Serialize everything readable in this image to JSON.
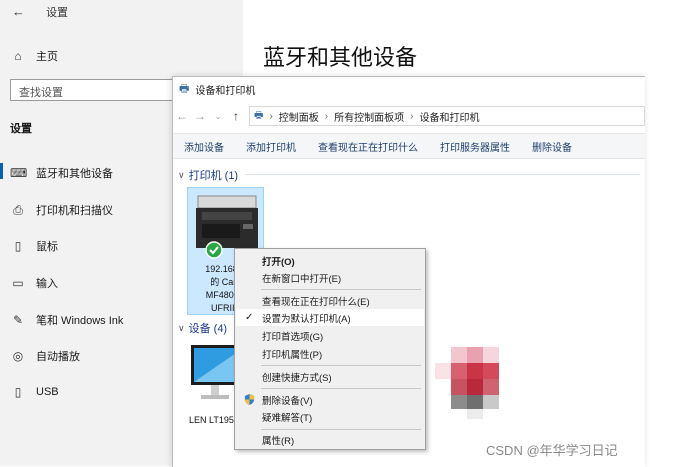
{
  "settings": {
    "back_label": "设置",
    "home": "主页",
    "search_placeholder": "查找设置",
    "section": "设置",
    "nav": [
      {
        "label": "蓝牙和其他设备",
        "icon": "bluetooth-devices-icon"
      },
      {
        "label": "打印机和扫描仪",
        "icon": "printer-icon"
      },
      {
        "label": "鼠标",
        "icon": "mouse-icon"
      },
      {
        "label": "输入",
        "icon": "keyboard-icon"
      },
      {
        "label": "笔和 Windows Ink",
        "icon": "pen-icon"
      },
      {
        "label": "自动播放",
        "icon": "autoplay-icon"
      },
      {
        "label": "USB",
        "icon": "usb-icon"
      }
    ],
    "page_title": "蓝牙和其他设备"
  },
  "explorer": {
    "title": "设备和打印机",
    "breadcrumbs": [
      "控制面板",
      "所有控制面板项",
      "设备和打印机"
    ],
    "commands": [
      "添加设备",
      "添加打印机",
      "查看现在正在打印什么",
      "打印服务器属性",
      "删除设备"
    ],
    "printers_group": "打印机 (1)",
    "devices_group": "设备 (4)",
    "printer_label_lines": [
      "192.168.3.",
      "的 Canc",
      "MF4800 S",
      "UFRII L"
    ],
    "device_label": "LEN LT195"
  },
  "context_menu": {
    "items": [
      {
        "label": "打开(O)",
        "bold": true
      },
      {
        "label": "在新窗口中打开(E)"
      },
      {
        "label": "查看现在正在打印什么(E)"
      },
      {
        "label": "设置为默认打印机(A)",
        "checked": true
      },
      {
        "label": "打印首选项(G)"
      },
      {
        "label": "打印机属性(P)"
      },
      {
        "label": "创建快捷方式(S)"
      },
      {
        "label": "删除设备(V)",
        "shield": true
      },
      {
        "label": "疑难解答(T)"
      },
      {
        "label": "属性(R)"
      }
    ]
  },
  "watermark": "CSDN @年华学习日记",
  "colors": {
    "accent": "#0a5fb4",
    "selection": "#cce8ff",
    "link": "#1e3f6e"
  }
}
